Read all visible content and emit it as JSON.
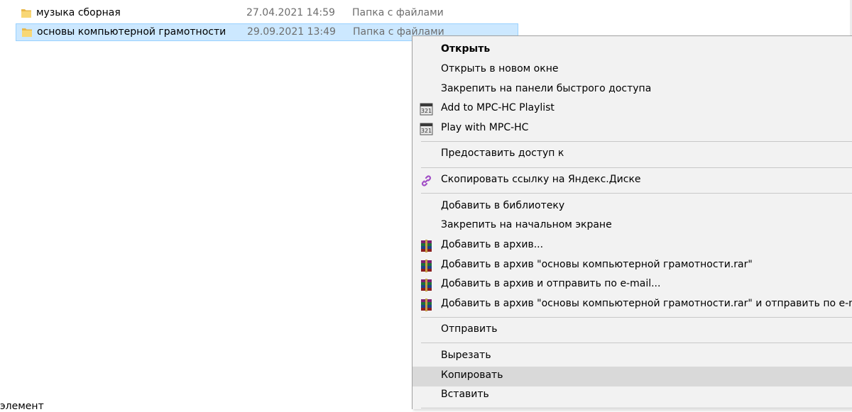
{
  "files": [
    {
      "name": "музыка сборная",
      "date": "27.04.2021 14:59",
      "type": "Папка с файлами"
    },
    {
      "name": "основы компьютерной грамотности",
      "date": "29.09.2021 13:49",
      "type": "Папка с файлами"
    }
  ],
  "status": {
    "text": "элемент"
  },
  "menu": {
    "open": "Открыть",
    "open_new_window": "Открыть в новом окне",
    "pin_quick_access": "Закрепить на панели быстрого доступа",
    "add_mpc_playlist": "Add to MPC-HC Playlist",
    "play_mpc": "Play with MPC-HC",
    "give_access": "Предоставить доступ к",
    "copy_yandex_link": "Скопировать ссылку на Яндекс.Диске",
    "add_library": "Добавить в библиотеку",
    "pin_start": "Закрепить на начальном экране",
    "add_archive": "Добавить в архив...",
    "add_archive_named": "Добавить в архив \"основы компьютерной грамотности.rar\"",
    "add_archive_email": "Добавить в архив и отправить по e-mail...",
    "add_archive_named_email": "Добавить в архив \"основы компьютерной грамотности.rar\" и отправить по e-mail",
    "send_to": "Отправить",
    "cut": "Вырезать",
    "copy": "Копировать",
    "paste": "Вставить"
  },
  "icons": {
    "folder": "folder-icon",
    "mpc": "mpc-hc-icon",
    "link": "yandex-link-icon",
    "winrar": "winrar-icon"
  },
  "colors": {
    "selection_bg": "#cce8ff",
    "selection_border": "#99d1ff",
    "menu_bg": "#f2f2f2",
    "menu_hover": "#d9d9d9",
    "folder_yellow": "#f8d775",
    "secondary_text": "#6d6d6d"
  }
}
